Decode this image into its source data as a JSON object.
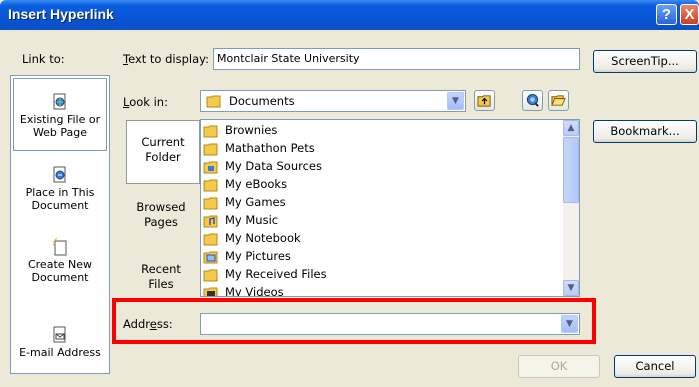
{
  "window": {
    "title": "Insert Hyperlink"
  },
  "titlebar": {
    "help_glyph": "?",
    "close_glyph": "X"
  },
  "link_to": {
    "label": "Link to:",
    "items": [
      {
        "label_line1": "Existing File or",
        "label_line2": "Web Page",
        "icon": "existing-file-icon"
      },
      {
        "label_line1": "Place in This",
        "label_line2": "Document",
        "icon": "place-in-document-icon"
      },
      {
        "label_line1": "Create New",
        "label_line2": "Document",
        "icon": "new-document-icon"
      },
      {
        "label_line1": "E-mail Address",
        "label_line2": "",
        "icon": "email-icon"
      }
    ]
  },
  "text_to_display": {
    "label": "Text to display:",
    "value": "Montclair State University"
  },
  "screentip": {
    "label": "ScreenTip..."
  },
  "look_in": {
    "label": "Look in:",
    "value": "Documents"
  },
  "bookmark": {
    "label": "Bookmark..."
  },
  "nav": {
    "items": [
      {
        "line1": "Current",
        "line2": "Folder"
      },
      {
        "line1": "Browsed",
        "line2": "Pages"
      },
      {
        "line1": "Recent",
        "line2": "Files"
      }
    ]
  },
  "files": [
    {
      "name": "Brownies",
      "icon": "folder-icon"
    },
    {
      "name": "Mathathon Pets",
      "icon": "folder-icon"
    },
    {
      "name": "My Data Sources",
      "icon": "data-sources-folder-icon"
    },
    {
      "name": "My eBooks",
      "icon": "folder-icon"
    },
    {
      "name": "My Games",
      "icon": "folder-icon"
    },
    {
      "name": "My Music",
      "icon": "music-folder-icon"
    },
    {
      "name": "My Notebook",
      "icon": "folder-icon"
    },
    {
      "name": "My Pictures",
      "icon": "pictures-folder-icon"
    },
    {
      "name": "My Received Files",
      "icon": "folder-icon"
    },
    {
      "name": "My Videos",
      "icon": "videos-folder-icon"
    }
  ],
  "address": {
    "label": "Address:",
    "value": ""
  },
  "buttons": {
    "ok": "OK",
    "cancel": "Cancel"
  },
  "colors": {
    "titlebar": "#0854d6",
    "highlight": "#ff0000",
    "dialog_bg": "#ece9d8",
    "folder": "#f5c949"
  }
}
